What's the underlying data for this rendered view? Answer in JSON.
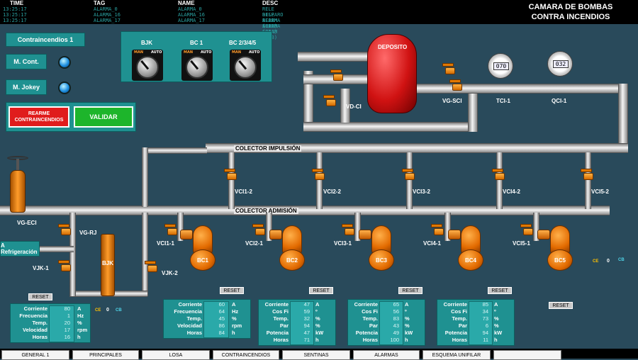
{
  "alarms": {
    "headers": {
      "time": "TIME",
      "tag": "TAG",
      "name": "NAME",
      "desc": "DESC"
    },
    "rows": [
      {
        "time": "13:25:17",
        "tag": "ALARMA_0",
        "name": "ALARMA_0",
        "desc": "RELE DISPARO SEPAM (013)"
      },
      {
        "time": "13:25:17",
        "tag": "ALARMA_16",
        "name": "ALARMA_16",
        "desc": "RELE ALARMA SEPAM (014)"
      },
      {
        "time": "13:25:17",
        "tag": "ALARMA_17",
        "name": "ALARMA_17",
        "desc": "RELE ALARMA SEPAM (013)"
      }
    ]
  },
  "title": {
    "line1": "CAMARA DE BOMBAS",
    "line2": "CONTRA INCENDIOS"
  },
  "left_panel": {
    "system_label": "Contraincendios 1",
    "m_cont": "M. Cont.",
    "m_jokey": "M. Jokey",
    "rearme_label": "REARME CONTRAINCENDIOS",
    "validar_label": "VALIDAR"
  },
  "selectors": {
    "labels": [
      "BJK",
      "BC 1",
      "BC 2/3/4/5"
    ],
    "man": "MAN",
    "auto": "AUTO"
  },
  "tank": {
    "label": "DEPOSITO"
  },
  "gauges": {
    "tci": "070",
    "qci": "032"
  },
  "labels": {
    "vd_ci": "VD-CI",
    "vg_sci": "VG-SCI",
    "tci_1": "TCI-1",
    "qci_1": "QCI-1",
    "colector_impulsion": "COLECTOR IMPULSIÓN",
    "colector_admision": "COLECTOR ADMISIÓN",
    "vci1_2": "VCI1-2",
    "vci2_2": "VCI2-2",
    "vci3_2": "VCI3-2",
    "vci4_2": "VCI4-2",
    "vci5_2": "VCI5-2",
    "vci1_1": "VCI1-1",
    "vci2_1": "VCI2-1",
    "vci3_1": "VCI3-1",
    "vci4_1": "VCI4-1",
    "vci5_1": "VCI5-1",
    "vg_eci": "VG-ECI",
    "vg_rj": "VG-RJ",
    "vjk_1": "VJK-1",
    "vjk_2": "VJK-2",
    "refrigeracion": "A Refrigeración",
    "bjk": "BJK",
    "ce": "CE",
    "zero": "0",
    "cb": "CB"
  },
  "pumps": [
    "BC1",
    "BC2",
    "BC3",
    "BC4",
    "BC5"
  ],
  "reset_label": "RESET",
  "tables": {
    "bjk": {
      "keys": [
        "Corriente",
        "Frecuencia",
        "Temp.",
        "Velocidad",
        "Horas"
      ],
      "values": [
        "80",
        "1",
        "20",
        "17",
        "16"
      ],
      "units": [
        "A",
        "Hz",
        "%",
        "rpm",
        "h"
      ]
    },
    "bc1": {
      "keys": [
        "Corriente",
        "Frecuencia",
        "Temp.",
        "Velocidad",
        "Horas"
      ],
      "values": [
        "60",
        "64",
        "45",
        "86",
        "84"
      ],
      "units": [
        "A",
        "Hz",
        "%",
        "rpm",
        "h"
      ]
    },
    "bc2": {
      "keys": [
        "Corriente",
        "Cos Fi",
        "Temp.",
        "Par",
        "Potencia",
        "Horas"
      ],
      "values": [
        "47",
        "59",
        "32",
        "94",
        "47",
        "71"
      ],
      "units": [
        "A",
        "º",
        "%",
        "%",
        "kW",
        "h"
      ]
    },
    "bc3": {
      "keys": [
        "Corriente",
        "Cos Fi",
        "Temp.",
        "Par",
        "Potencia",
        "Horas"
      ],
      "values": [
        "65",
        "56",
        "83",
        "43",
        "49",
        "100"
      ],
      "units": [
        "A",
        "º",
        "%",
        "%",
        "kW",
        "h"
      ]
    },
    "bc4": {
      "keys": [
        "Corriente",
        "Cos Fi",
        "Temp.",
        "Par",
        "Potencia",
        "Horas"
      ],
      "values": [
        "85",
        "34",
        "73",
        "6",
        "94",
        "11"
      ],
      "units": [
        "A",
        "º",
        "%",
        "%",
        "kW",
        "h"
      ]
    }
  },
  "nav": [
    "GENERAL 1",
    "PRINCIPALES",
    "LOSA",
    "CONTRAINCENDIOS",
    "SENTINAS",
    "ALARMAS",
    "ESQUEMA UNIFILAR",
    ""
  ]
}
